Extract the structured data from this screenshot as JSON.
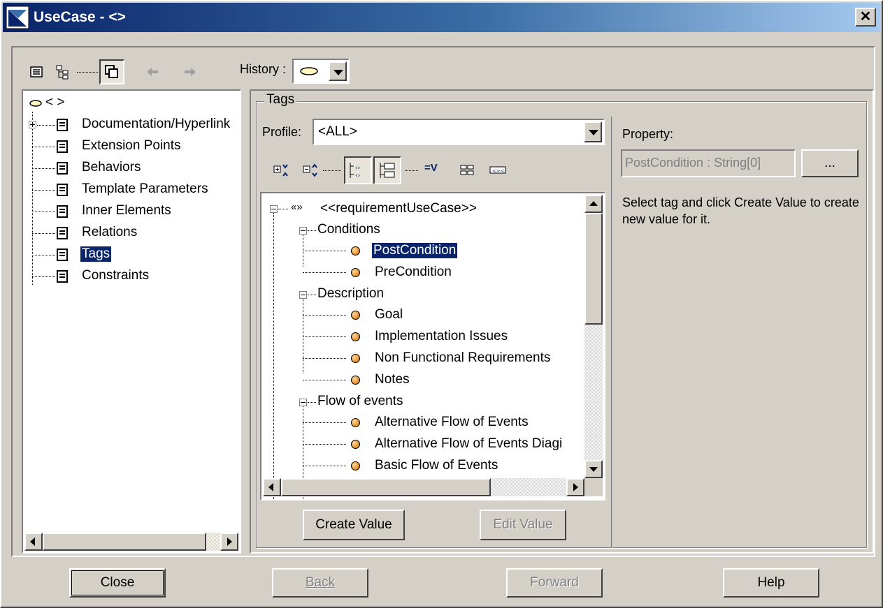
{
  "window": {
    "title": "UseCase - <>",
    "close_glyph": "✕"
  },
  "toolbar": {
    "history_label": "History :",
    "icons": [
      "list-icon",
      "tree-icon",
      "copy-icon",
      "arrow-left-icon",
      "arrow-right-icon"
    ]
  },
  "left_tree": {
    "root_label": "< >",
    "items": [
      {
        "label": "Documentation/Hyperlink"
      },
      {
        "label": "Extension Points"
      },
      {
        "label": "Behaviors"
      },
      {
        "label": "Template Parameters"
      },
      {
        "label": "Inner Elements"
      },
      {
        "label": "Relations"
      },
      {
        "label": "Tags"
      },
      {
        "label": "Constraints"
      }
    ],
    "selected": "Tags"
  },
  "tags_panel": {
    "group_title": "Tags",
    "profile_label": "Profile:",
    "profile_value": "<ALL>",
    "stereotype_prefix": "«»",
    "stereotype": "<<requirementUseCase>>",
    "groups": [
      {
        "label": "Conditions",
        "items": [
          "PostCondition",
          "PreCondition"
        ]
      },
      {
        "label": "Description",
        "items": [
          "Goal",
          "Implementation Issues",
          "Non Functional Requirements",
          "Notes"
        ]
      },
      {
        "label": "Flow of events",
        "items": [
          "Alternative Flow of Events",
          "Alternative Flow of Events Diagi",
          "Basic Flow of Events"
        ]
      }
    ],
    "selected_tag": "PostCondition",
    "create_value_label": "Create Value",
    "edit_value_label": "Edit Value",
    "equals_v": "=V"
  },
  "property_panel": {
    "label": "Property:",
    "value": "PostCondition : String[0]",
    "browse_label": "...",
    "hint": "Select tag and click Create Value to create new value for it."
  },
  "footer": {
    "close": "Close",
    "back": "Back",
    "forward": "Forward",
    "help": "Help"
  }
}
